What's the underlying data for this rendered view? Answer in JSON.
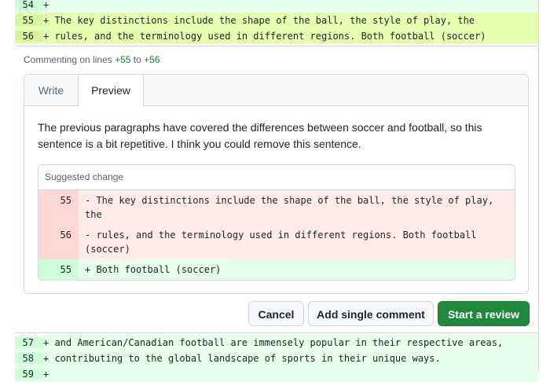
{
  "diff_top": [
    {
      "num": "54",
      "code": "+"
    },
    {
      "num": "55",
      "code": "+ The key distinctions include the shape of the ball, the style of play, the"
    },
    {
      "num": "56",
      "code": "+ rules, and the terminology used in different regions. Both football (soccer)"
    }
  ],
  "commenting": {
    "prefix": "Commenting on lines",
    "from": "+55",
    "to_word": "to",
    "to": "+56"
  },
  "tabs": {
    "write": "Write",
    "preview": "Preview"
  },
  "preview_text": "The previous paragraphs have covered the differences between soccer and football, so this sentence is a bit repetitive. I think you could remove this sentence.",
  "suggested": {
    "header": "Suggested change",
    "rows": [
      {
        "num": "55",
        "code": "- The key distinctions include the shape of the ball, the style of play, the"
      },
      {
        "num": "56",
        "code": "- rules, and the terminology used in different regions. Both football (soccer)"
      },
      {
        "num": "55",
        "code": "+ Both football (soccer)"
      }
    ]
  },
  "buttons": {
    "cancel": "Cancel",
    "single": "Add single comment",
    "review": "Start a review"
  },
  "diff_bottom": [
    {
      "num": "57",
      "code": "+ and American/Canadian football are immensely popular in their respective areas,"
    },
    {
      "num": "58",
      "code": "+ contributing to the global landscape of sports in their unique ways."
    },
    {
      "num": "59",
      "code": "+"
    }
  ],
  "colors": {
    "add_bg": "#e6ffec",
    "selected_bg": "#e6ffb0",
    "del_bg": "#ffebe9",
    "primary": "#1f883d"
  }
}
